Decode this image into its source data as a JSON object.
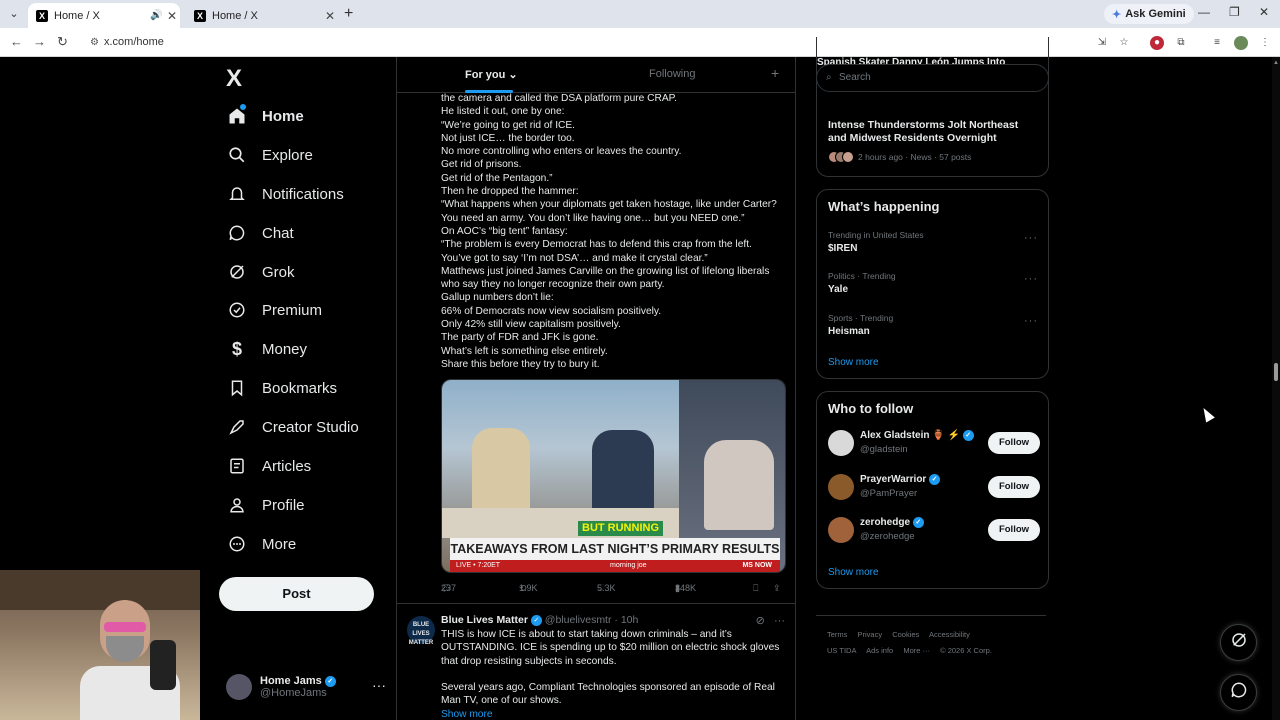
{
  "browser": {
    "tabs": [
      {
        "title": "Home / X",
        "favicon": "X"
      },
      {
        "title": "Home / X",
        "favicon": "X"
      }
    ],
    "new_tab": "+",
    "ask_gemini": "Ask Gemini",
    "url": "x.com/home"
  },
  "leftnav": {
    "logo": "X",
    "items": [
      {
        "label": "Home",
        "icon": "home-icon"
      },
      {
        "label": "Explore",
        "icon": "search-icon"
      },
      {
        "label": "Notifications",
        "icon": "bell-icon"
      },
      {
        "label": "Chat",
        "icon": "chat-icon"
      },
      {
        "label": "Grok",
        "icon": "grok-icon"
      },
      {
        "label": "Premium",
        "icon": "premium-icon"
      },
      {
        "label": "Money",
        "icon": "money-icon"
      },
      {
        "label": "Bookmarks",
        "icon": "bookmark-icon"
      },
      {
        "label": "Creator Studio",
        "icon": "rocket-icon"
      },
      {
        "label": "Articles",
        "icon": "article-icon"
      },
      {
        "label": "Profile",
        "icon": "profile-icon"
      },
      {
        "label": "More",
        "icon": "more-circle-icon"
      }
    ],
    "post": "Post",
    "account": {
      "name": "Home Jams",
      "handle": "@HomeJams"
    }
  },
  "feed": {
    "tabs": {
      "for_you": "For you",
      "following": "Following",
      "plus": "+"
    },
    "tweet1_lines": [
      "the camera and called the DSA platform pure CRAP.",
      "He listed it out, one by one:",
      "“We’re going to get rid of ICE.",
      "Not just ICE… the border too.",
      "No more controlling who enters or leaves the country.",
      "Get rid of prisons.",
      "Get rid of the Pentagon.”",
      "Then he dropped the hammer:",
      "“What happens when your diplomats get taken hostage, like under Carter?",
      "You need an army. You don’t like having one… but you NEED one.”",
      "On AOC’s “big tent” fantasy:",
      "“The problem is every Democrat has to defend this crap from the left.",
      "You’ve got to say ‘I’m not DSA’… and make it crystal clear.”",
      "Matthews just joined James Carville on the growing list of lifelong liberals",
      "who say they no longer recognize their own party.",
      "Gallup numbers don’t lie:",
      "66% of Democrats now view socialism positively.",
      "Only 42% still view capitalism positively.",
      "The party of FDR and JFK is gone.",
      "What’s left is something else entirely.",
      "Share this before they try to bury it."
    ],
    "media": {
      "green_tag": "BUT RUNNING",
      "lower_third": "TAKEAWAYS FROM LAST NIGHT’S PRIMARY RESULTS",
      "live": "LIVE • 7:20ET",
      "show": "morning joe",
      "network": "MS NOW"
    },
    "actions": {
      "replies": "237",
      "reposts": "1.9K",
      "likes": "5.3K",
      "views": "348K"
    },
    "tweet2": {
      "avatar_text": "BLUE LIVES MATTER",
      "name": "Blue Lives Matter",
      "handle": "@bluelivesmtr",
      "time": "· 10h",
      "lines": [
        "THIS is how ICE is about to start taking down criminals – and it’s",
        "OUTSTANDING.  ICE is spending up to $20 million on electric shock gloves",
        "that drop resisting subjects in seconds.",
        "",
        "Several years ago, Compliant Technologies sponsored an episode of Real",
        "Man TV, one of our shows."
      ],
      "show_more": "Show more"
    }
  },
  "right": {
    "search_placeholder": "Search",
    "clipped_headline": "Spanish Skater Danny León Jumps Into",
    "news": {
      "title": "Intense Thunderstorms Jolt Northeast and Midwest Residents Overnight",
      "meta": "2 hours ago · News · 57 posts"
    },
    "happening": {
      "title": "What’s happening",
      "trends": [
        {
          "context": "Trending in United States",
          "name": "$IREN"
        },
        {
          "context": "Politics · Trending",
          "name": "Yale"
        },
        {
          "context": "Sports · Trending",
          "name": "Heisman"
        }
      ],
      "show_more": "Show more"
    },
    "who_to_follow": {
      "title": "Who to follow",
      "accounts": [
        {
          "name": "Alex Gladstein",
          "emoji": "🏺 ⚡",
          "handle": "@gladstein",
          "button": "Follow"
        },
        {
          "name": "PrayerWarrior",
          "emoji": "",
          "handle": "@PamPrayer",
          "button": "Follow"
        },
        {
          "name": "zerohedge",
          "emoji": "",
          "handle": "@zerohedge",
          "button": "Follow"
        }
      ],
      "show_more": "Show more"
    },
    "footer": {
      "row1": [
        "Terms",
        "Privacy",
        "Cookies",
        "Accessibility"
      ],
      "row2": [
        "US TIDA",
        "Ads info",
        "More ···",
        "© 2026 X Corp."
      ]
    }
  },
  "colors": {
    "accent": "#1d9bf0",
    "background": "#000000",
    "border": "#2f3336",
    "muted": "#71767b"
  }
}
